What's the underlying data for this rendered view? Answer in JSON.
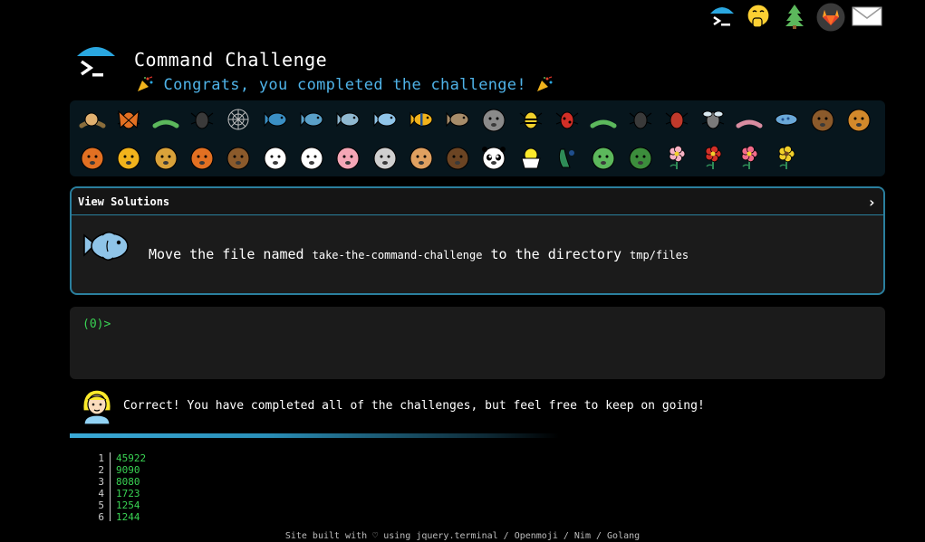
{
  "header": {
    "title": "Command Challenge",
    "subtitle": "Congrats, you completed the challenge!"
  },
  "topnav": {
    "items": [
      {
        "icon": "terminal-umbrella-icon"
      },
      {
        "icon": "face-hand-over-mouth-icon"
      },
      {
        "icon": "evergreen-tree-icon"
      },
      {
        "icon": "gitlab-icon"
      },
      {
        "icon": "envelope-icon"
      }
    ]
  },
  "emoji_panel": {
    "row1": [
      "snail",
      "butterfly",
      "bug",
      "ant",
      "spider-web",
      "whale",
      "shark",
      "dolphin",
      "fish",
      "tropical-fish",
      "blowfish",
      "wolf",
      "bee",
      "lady-beetle",
      "lizard",
      "spider",
      "scorpion",
      "fly",
      "worm",
      "microbe",
      "monkey",
      "dog"
    ],
    "row2": [
      "fox",
      "cat",
      "lion",
      "tiger",
      "horse",
      "unicorn",
      "cow",
      "pig",
      "mouse",
      "hamster",
      "bear",
      "panda",
      "hatching-chick",
      "peacock",
      "frog",
      "dragon",
      "cherry-blossom",
      "rose",
      "hibiscus",
      "sunflower"
    ]
  },
  "solutions": {
    "title": "View Solutions",
    "chevron": "›"
  },
  "challenge": {
    "part1": "Move the file named ",
    "file": "take-the-command-challenge",
    "part2": " to the directory ",
    "dir": "tmp/files"
  },
  "terminal": {
    "prompt": "(0)>"
  },
  "result": {
    "message": "Correct! You have completed all of the challenges, but feel free to keep on going!"
  },
  "output": {
    "lines": [
      {
        "num": "1",
        "val": "45922"
      },
      {
        "num": "2",
        "val": "9090"
      },
      {
        "num": "3",
        "val": "8080"
      },
      {
        "num": "4",
        "val": "1723"
      },
      {
        "num": "5",
        "val": "1254"
      },
      {
        "num": "6",
        "val": "1244"
      }
    ]
  },
  "footer": {
    "text": "Site built with ♡ using jquery.terminal / Openmoji / Nim / Golang"
  },
  "colors": {
    "accent": "#4fb3e8",
    "border": "#2a7f9e",
    "prompt": "#39d353",
    "panel_bg": "#07161d",
    "box_bg": "#1b1b1b"
  }
}
